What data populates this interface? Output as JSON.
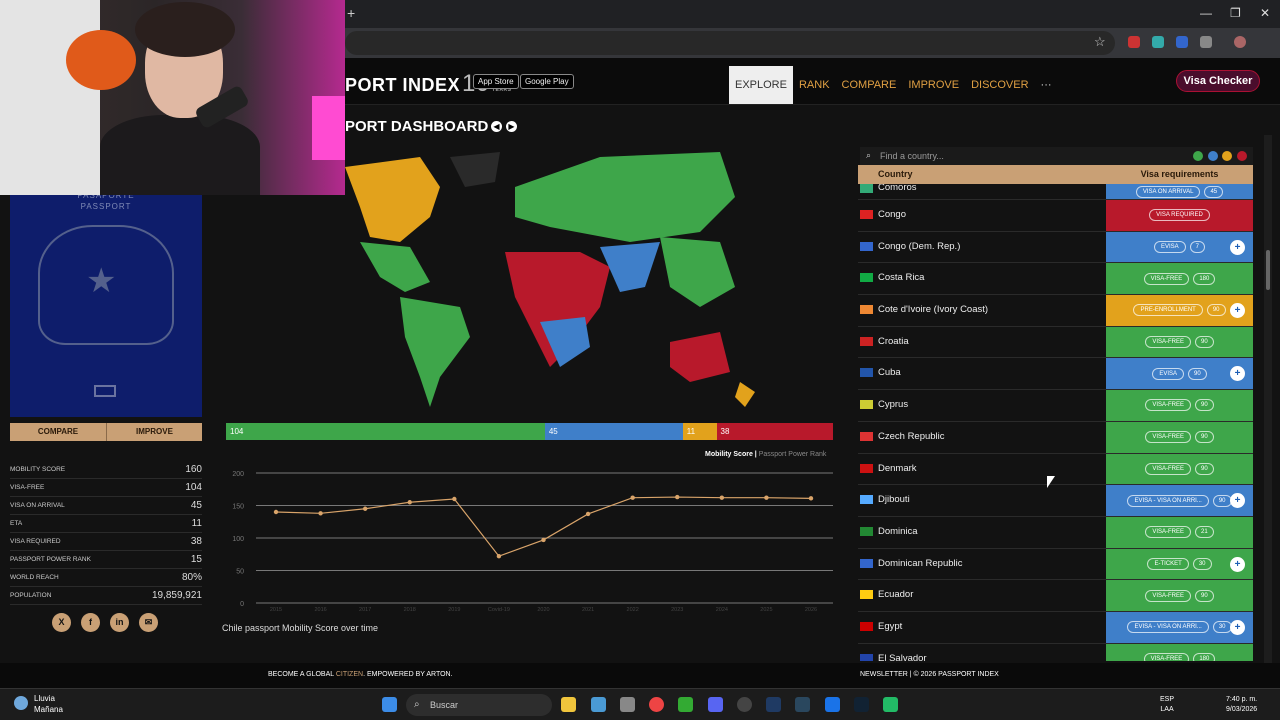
{
  "browser": {
    "newtab": "+",
    "min": "—",
    "max": "❐",
    "close": "✕",
    "star": "☆"
  },
  "site": {
    "logo": "PORT INDEX",
    "logo_badge": "10",
    "logo_badge_sub": "YEARS",
    "appstore": "App Store",
    "googleplay": "Google Play",
    "nav": [
      "EXPLORE",
      "RANK",
      "COMPARE",
      "IMPROVE",
      "DISCOVER",
      "···"
    ],
    "visa_checker": "Visa Checker"
  },
  "dashboard": {
    "title": "PORT DASHBOARD",
    "prev": "◀",
    "next": "▶"
  },
  "passport": {
    "top": "PASAPORTE",
    "sub": "PASSPORT"
  },
  "buttons": {
    "compare": "COMPARE",
    "improve": "IMPROVE"
  },
  "stats": [
    {
      "k": "MOBILITY SCORE",
      "v": "160"
    },
    {
      "k": "VISA-FREE",
      "v": "104"
    },
    {
      "k": "VISA ON ARRIVAL",
      "v": "45"
    },
    {
      "k": "ETA",
      "v": "11"
    },
    {
      "k": "VISA REQUIRED",
      "v": "38"
    },
    {
      "k": "PASSPORT POWER RANK",
      "v": "15"
    },
    {
      "k": "WORLD REACH",
      "v": "80%"
    },
    {
      "k": "POPULATION",
      "v": "19,859,921"
    }
  ],
  "socials": [
    "X",
    "f",
    "in",
    "✉"
  ],
  "breakdown": [
    {
      "label": "104",
      "value": 104,
      "color": "#3ea64a"
    },
    {
      "label": "45",
      "value": 45,
      "color": "#3f7fc9"
    },
    {
      "label": "11",
      "value": 11,
      "color": "#e2a21c"
    },
    {
      "label": "38",
      "value": 38,
      "color": "#b8192b"
    }
  ],
  "chart_legend": {
    "main": "Mobility Score",
    "sep": " | ",
    "secondary": "Passport Power Rank"
  },
  "chart_caption": "Chile passport Mobility Score over time",
  "chart_data": {
    "type": "line",
    "x": [
      "2015",
      "2016",
      "2017",
      "2018",
      "2019",
      "Covid-19",
      "2020",
      "2021",
      "2022",
      "2023",
      "2024",
      "2025",
      "2026"
    ],
    "series": [
      {
        "values": [
          140,
          138,
          145,
          155,
          160,
          72,
          97,
          137,
          162,
          163,
          162,
          162,
          161
        ]
      }
    ],
    "ylim": [
      0,
      200
    ],
    "yticks": [
      0,
      50,
      100,
      150,
      200
    ],
    "color": "#d9a46a",
    "grid": true
  },
  "right": {
    "search_icon": "search-icon",
    "search_placeholder": "Find a country...",
    "col_country": "Country",
    "col_visa": "Visa requirements",
    "legend_dots": [
      "#3ea64a",
      "#3f7fc9",
      "#e2a21c",
      "#b8192b"
    ]
  },
  "countries": [
    {
      "name": "Comoros",
      "req": "VISA ON ARRIVAL",
      "days": "45",
      "color": "#3f7fc9",
      "plus": false
    },
    {
      "name": "Congo",
      "req": "VISA REQUIRED",
      "days": "",
      "color": "#b8192b",
      "plus": false
    },
    {
      "name": "Congo (Dem. Rep.)",
      "req": "EVISA",
      "days": "7",
      "color": "#3f7fc9",
      "plus": true
    },
    {
      "name": "Costa Rica",
      "req": "VISA-FREE",
      "days": "180",
      "color": "#3ea64a",
      "plus": false
    },
    {
      "name": "Cote d'Ivoire (Ivory Coast)",
      "req": "PRE-ENROLLMENT",
      "days": "90",
      "color": "#e2a21c",
      "plus": true
    },
    {
      "name": "Croatia",
      "req": "VISA-FREE",
      "days": "90",
      "color": "#3ea64a",
      "plus": false
    },
    {
      "name": "Cuba",
      "req": "EVISA",
      "days": "90",
      "color": "#3f7fc9",
      "plus": true
    },
    {
      "name": "Cyprus",
      "req": "VISA-FREE",
      "days": "90",
      "color": "#3ea64a",
      "plus": false
    },
    {
      "name": "Czech Republic",
      "req": "VISA-FREE",
      "days": "90",
      "color": "#3ea64a",
      "plus": false
    },
    {
      "name": "Denmark",
      "req": "VISA-FREE",
      "days": "90",
      "color": "#3ea64a",
      "plus": false
    },
    {
      "name": "Djibouti",
      "req": "EVISA - VISA ON ARRI...",
      "days": "90",
      "color": "#3f7fc9",
      "plus": true
    },
    {
      "name": "Dominica",
      "req": "VISA-FREE",
      "days": "21",
      "color": "#3ea64a",
      "plus": false
    },
    {
      "name": "Dominican Republic",
      "req": "E-TICKET",
      "days": "30",
      "color": "#3ea64a",
      "plus": true
    },
    {
      "name": "Ecuador",
      "req": "VISA-FREE",
      "days": "90",
      "color": "#3ea64a",
      "plus": false
    },
    {
      "name": "Egypt",
      "req": "EVISA - VISA ON ARRI...",
      "days": "30",
      "color": "#3f7fc9",
      "plus": true
    },
    {
      "name": "El Salvador",
      "req": "VISA-FREE",
      "days": "180",
      "color": "#3ea64a",
      "plus": false
    }
  ],
  "footer": {
    "left_a": "BECOME A GLOBAL ",
    "left_b": "CITIZEN",
    "left_c": ".   EMPOWERED BY ",
    "left_d": "ARTON",
    "left_e": ".",
    "right": "NEWSLETTER  |  © 2026 PASSPORT INDEX"
  },
  "taskbar": {
    "weather_temp": "Lluvia",
    "weather_time": "Mañana",
    "search": "Buscar",
    "lang": "ESP",
    "lang2": "LAA",
    "time": "7:40 p. m.",
    "date": "9/03/2026"
  }
}
